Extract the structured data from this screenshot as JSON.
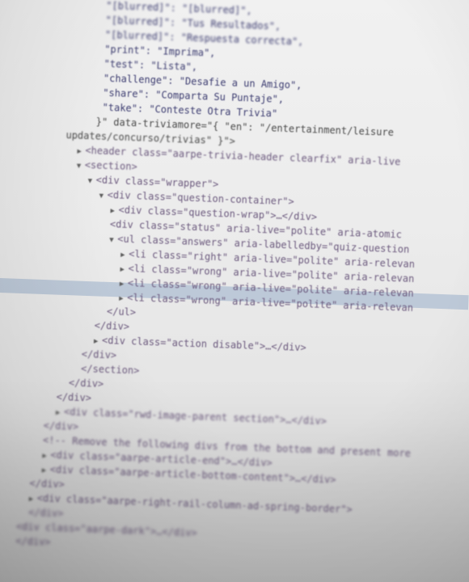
{
  "window": {
    "title": "",
    "theme": {
      "background": "#ececec",
      "selected_row": "#7697bc",
      "tag_color": "#7a4f86",
      "attribute_color": "#8b6a2c",
      "value_color": "#2d3a7e"
    }
  },
  "code": {
    "lines": [
      {
        "indent": 18,
        "text": "\"[blurred]\": \"[blurred]\",",
        "blur": 3
      },
      {
        "indent": 18,
        "text": "\"[blurred]\": \"Tus Resultados\",",
        "blur": 3
      },
      {
        "indent": 18,
        "text": "\"[blurred]\": \"Respuesta correcta\",",
        "blur": 3
      },
      {
        "indent": 18,
        "text": "\"print\": \"Imprima\",",
        "blur": 2
      },
      {
        "indent": 18,
        "text": "\"test\": \"Lista\",",
        "blur": 2
      },
      {
        "indent": 18,
        "text": "\"challenge\": \"Desafie a un Amigo\",",
        "blur": 1
      },
      {
        "indent": 18,
        "text": "\"share\": \"Comparta Su Puntaje\",",
        "blur": 1
      },
      {
        "indent": 18,
        "text": "\"take\": \"Conteste Otra Trivia\"",
        "blur": 1
      },
      {
        "indent": 17,
        "text": "}\" data-triviamore=\"{ \"en\": \"/entertainment/leisure",
        "blur": 1
      },
      {
        "indent": 12,
        "text": "updates/concurso/trivias\" }\">",
        "blur": 2
      },
      {
        "indent": 14,
        "text": "<header class=\"aarpe-trivia-header clearfix\" aria-live",
        "blur": 2,
        "tri": "▶"
      },
      {
        "indent": 14,
        "text": "<section>",
        "blur": 2,
        "tri": "▼"
      },
      {
        "indent": 16,
        "text": "<div class=\"wrapper\">",
        "blur": 1,
        "tri": "▼"
      },
      {
        "indent": 18,
        "text": "<div class=\"question-container\">",
        "blur": 1,
        "tri": "▼"
      },
      {
        "indent": 20,
        "text": "<div class=\"question-wrap\">…</div>",
        "blur": 1,
        "tri": "▶"
      },
      {
        "indent": 20,
        "text": "<div class=\"status\" aria-live=\"polite\" aria-atomic",
        "blur": 1
      },
      {
        "indent": 20,
        "text": "<ul class=\"answers\" aria-labelledby=\"quiz-question",
        "blur": 1,
        "tri": "▼"
      },
      {
        "indent": 22,
        "text": "<li class=\"right\" aria-live=\"polite\" aria-relevan",
        "blur": 1,
        "tri": "▶"
      },
      {
        "indent": 22,
        "text": "<li class=\"wrong\" aria-live=\"polite\" aria-relevan",
        "blur": 1,
        "tri": "▶"
      },
      {
        "indent": 22,
        "text": "<li class=\"wrong\" aria-live=\"polite\" aria-relevan",
        "blur": 1,
        "tri": "▶"
      },
      {
        "indent": 22,
        "text": "<li class=\"wrong\" aria-live=\"polite\" aria-relevan",
        "blur": 1,
        "tri": "▶"
      },
      {
        "indent": 20,
        "text": "</ul>",
        "blur": 1
      },
      {
        "indent": 18,
        "text": "</div>",
        "blur": 1
      },
      {
        "indent": 18,
        "text": "<div class=\"action disable\">…</div>",
        "blur": 1,
        "tri": "▶"
      },
      {
        "indent": 16,
        "text": "</div>",
        "blur": 2
      },
      {
        "indent": 16,
        "text": "</section>",
        "blur": 2
      },
      {
        "indent": 14,
        "text": "</div>",
        "blur": 2
      },
      {
        "indent": 12,
        "text": "</div>",
        "blur": 2
      },
      {
        "indent": 12,
        "text": "<div class=\"rwd-image-parent section\">…</div>",
        "blur": 3,
        "tri": "▶"
      },
      {
        "indent": 10,
        "text": "</div>",
        "blur": 3
      },
      {
        "indent": 10,
        "text": "<!-- Remove the following divs from the bottom and present more",
        "blur": 3
      },
      {
        "indent": 10,
        "text": "<div class=\"aarpe-article-end\">…</div>",
        "blur": 3,
        "tri": "▶"
      },
      {
        "indent": 10,
        "text": "<div class=\"aarpe-article-bottom-content\">…</div>",
        "blur": 3,
        "tri": "▶"
      },
      {
        "indent": 8,
        "text": "</div>",
        "blur": 3
      },
      {
        "indent": 8,
        "text": "<div class=\"aarpe-right-rail-column-ad-spring-border\">",
        "blur": 3,
        "tri": "▶"
      },
      {
        "indent": 8,
        "text": "</div>",
        "blur": 4
      },
      {
        "indent": 6,
        "text": "<div class=\"aarpe-dark\">…</div>",
        "blur": 4
      },
      {
        "indent": 6,
        "text": "</div>",
        "blur": 4
      }
    ]
  }
}
